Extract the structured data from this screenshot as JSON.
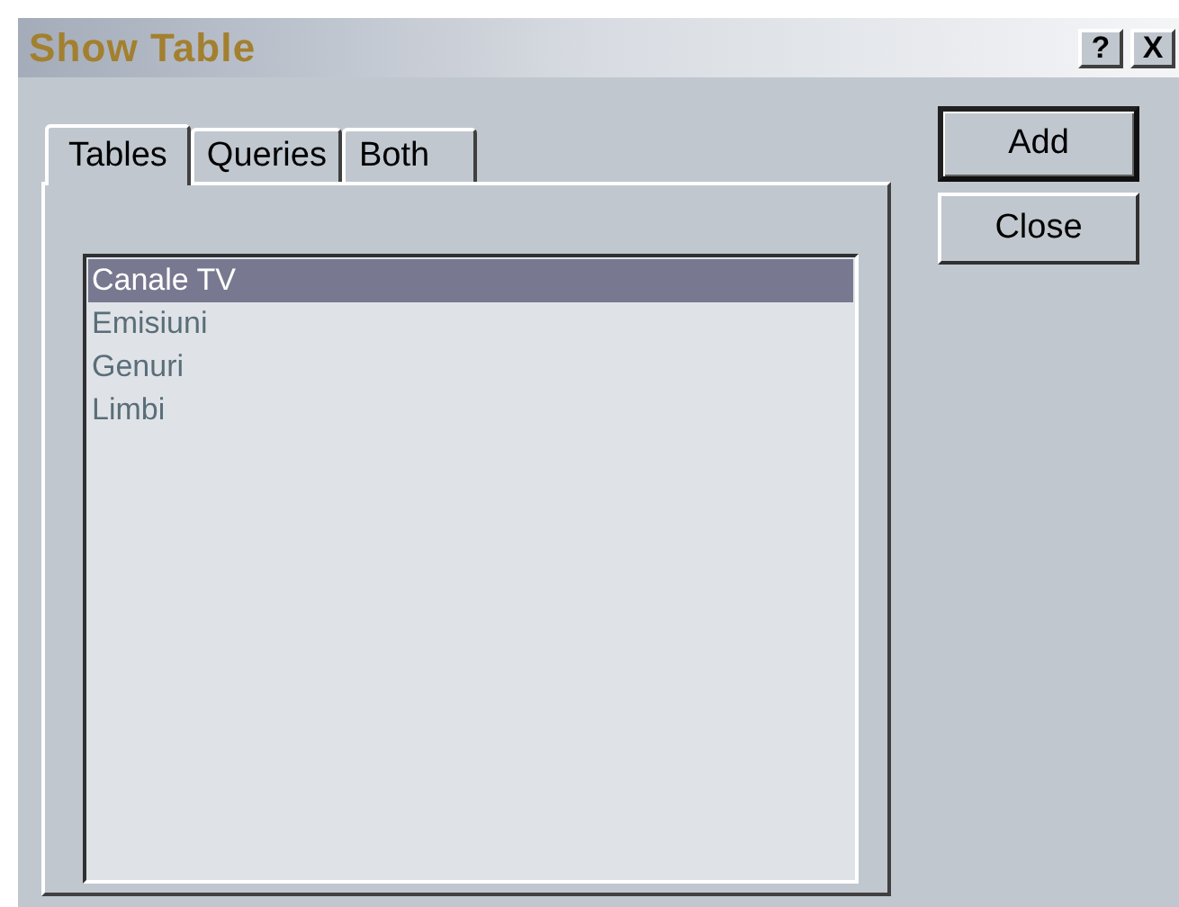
{
  "window": {
    "title": "Show Table",
    "title_buttons": [
      "?",
      "X"
    ]
  },
  "tabs": [
    {
      "label": "Tables",
      "selected": true
    },
    {
      "label": "Queries",
      "selected": false
    },
    {
      "label": "Both",
      "selected": false
    }
  ],
  "list": {
    "items": [
      {
        "label": "Canale TV",
        "selected": true
      },
      {
        "label": "Emisiuni",
        "selected": false
      },
      {
        "label": "Genuri",
        "selected": false
      },
      {
        "label": "Limbi",
        "selected": false
      }
    ]
  },
  "buttons": [
    {
      "label": "Add",
      "default": true
    },
    {
      "label": "Close",
      "default": false
    }
  ]
}
